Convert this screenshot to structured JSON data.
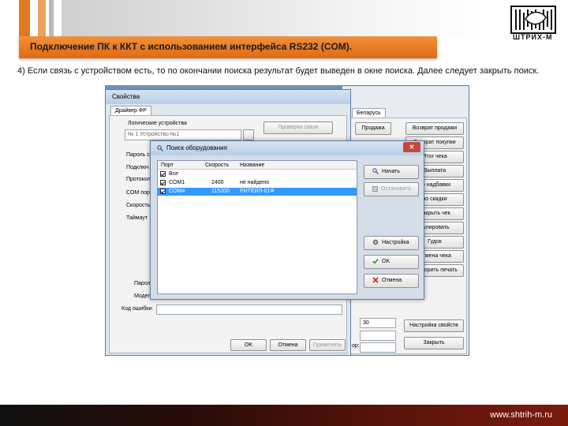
{
  "slide": {
    "title": "Подключение ПК к ККТ с использованием интерфейса RS232 (COM).",
    "caption": "4) Если связь с устройством есть, то по окончании поиска результат будет выведен в окне поиска. Далее следует закрыть поиск.",
    "logo_text": "ШТРИХ-М",
    "footer_url": "www.shtrih-m.ru",
    "colors": {
      "accent": "#e87a1e",
      "footer": "#5a140a"
    }
  },
  "props_window": {
    "title": "Свойства",
    "tab": "Драйвер ФР",
    "group_label": "Логические устройства",
    "device_select": "№ 1 Устройство №1",
    "check_link_button": "Проверка связи",
    "labels": [
      "Пароль с",
      "Подключ",
      "Протокол",
      "COM порт",
      "Скорость",
      "Таймаут"
    ],
    "bottom_labels": [
      "Пароль",
      "Модель",
      "Код ошибки:"
    ],
    "ok_button": "OK",
    "cancel_button": "Отмена",
    "apply_button": "Применить"
  },
  "right_window": {
    "tab": "Беларусь",
    "buttons_left": [
      "Продажа"
    ],
    "buttons_right": [
      "Возврат продажи",
      "Возврат покупки",
      "Итог чека",
      "Выплата",
      "но надбавки",
      "но скидки",
      "Закрыть чек",
      "нулировать",
      "Гудок",
      "Отмена чека",
      "Повторить печать"
    ],
    "field_value": "30",
    "props_button": "Настройка свойств",
    "close_button": "Закрыть",
    "side_label": "ор:"
  },
  "search_dialog": {
    "title": "Поиск оборудования",
    "columns": [
      "Порт",
      "Скорость",
      "Название"
    ],
    "rows": [
      {
        "port": "Все",
        "speed": "",
        "name": "",
        "checked": true,
        "selected": false
      },
      {
        "port": "COM1",
        "speed": "2400",
        "name": "не найдено",
        "checked": true,
        "selected": false
      },
      {
        "port": "COM4",
        "speed": "115200",
        "name": "РИТЕЙЛ-01Ф",
        "checked": true,
        "selected": true
      }
    ],
    "start_button": "Начать",
    "stop_button": "Остановить",
    "settings_button": "Настройка",
    "ok_button": "OK",
    "cancel_button": "Отмена",
    "icons": [
      "search-icon",
      "stop-icon",
      "settings-icon",
      "checkmark-icon",
      "close-icon"
    ]
  }
}
